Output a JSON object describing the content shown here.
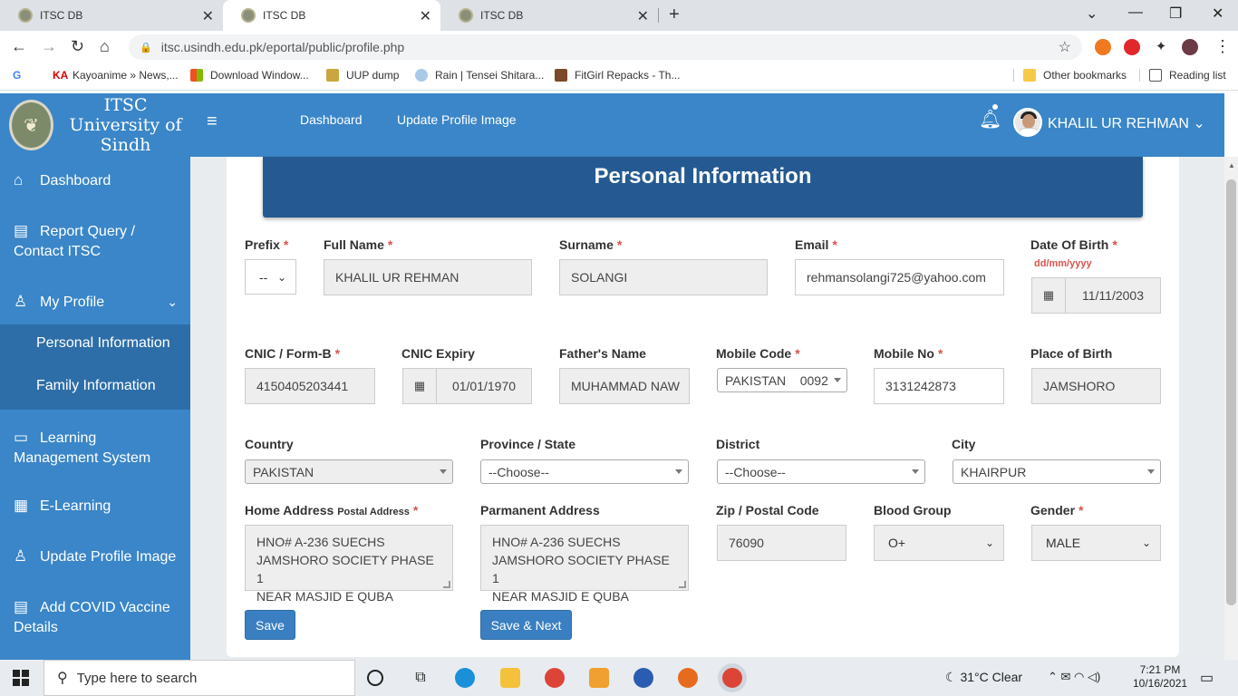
{
  "browser": {
    "tabs": [
      {
        "title": "ITSC DB",
        "close": "✕"
      },
      {
        "title": "ITSC DB",
        "close": "✕"
      },
      {
        "title": "ITSC DB",
        "close": "✕"
      }
    ],
    "new_tab": "+",
    "url": "itsc.usindh.edu.pk/eportal/public/profile.php",
    "bookmarks": [
      "Kayoanime » News,...",
      "Download Window...",
      "UUP dump",
      "Rain | Tensei Shitara...",
      "FitGirl Repacks - Th..."
    ],
    "other_bookmarks": "Other bookmarks",
    "reading_list": "Reading list"
  },
  "sidebar": {
    "brand_line1": "ITSC",
    "brand_line2": "University of Sindh",
    "items": [
      {
        "label": "Dashboard",
        "icon": "home-icon"
      },
      {
        "label": "Report Query /",
        "label2": "Contact ITSC",
        "icon": "document-icon"
      },
      {
        "label": "My Profile",
        "icon": "user-icon"
      },
      {
        "label": "Learning",
        "label2": "Management System",
        "icon": "lms-icon"
      },
      {
        "label": "E-Learning",
        "icon": "calculator-icon"
      },
      {
        "label": "Update Profile Image",
        "icon": "user-icon"
      },
      {
        "label": "Add COVID Vaccine",
        "label2": "Details",
        "icon": "document-icon"
      }
    ],
    "sub_items": [
      "Personal Information",
      "Family Information"
    ]
  },
  "header": {
    "links": [
      "Dashboard",
      "Update Profile Image"
    ],
    "user_name": "KHALIL UR REHMAN"
  },
  "form": {
    "title": "Personal Information",
    "prefix": {
      "label": "Prefix",
      "value": "--"
    },
    "full_name": {
      "label": "Full Name",
      "value": "KHALIL UR REHMAN"
    },
    "surname": {
      "label": "Surname",
      "value": "SOLANGI"
    },
    "email": {
      "label": "Email",
      "value": "rehmansolangi725@yahoo.com"
    },
    "dob": {
      "label": "Date Of Birth",
      "hint": "dd/mm/yyyy",
      "value": "11/11/2003"
    },
    "cnic": {
      "label": "CNIC / Form-B",
      "value": "4150405203441"
    },
    "cnic_expiry": {
      "label": "CNIC Expiry",
      "value": "01/01/1970"
    },
    "father_name": {
      "label": "Father's Name",
      "value": "MUHAMMAD NAW"
    },
    "mobile_code": {
      "label": "Mobile Code",
      "value": "PAKISTAN    0092"
    },
    "mobile_no": {
      "label": "Mobile No",
      "value": "3131242873"
    },
    "place_of_birth": {
      "label": "Place of Birth",
      "value": "JAMSHORO"
    },
    "country": {
      "label": "Country",
      "value": "PAKISTAN"
    },
    "province": {
      "label": "Province / State",
      "value": "--Choose--"
    },
    "district": {
      "label": "District",
      "value": "--Choose--"
    },
    "city": {
      "label": "City",
      "value": "KHAIRPUR"
    },
    "home_address": {
      "label": "Home Address",
      "sub": "Postal Address",
      "lines": [
        "HNO# A-236 SUECHS",
        "JAMSHORO SOCIETY PHASE 1",
        "NEAR MASJID E QUBA"
      ]
    },
    "permanent_address": {
      "label": "Parmanent Address",
      "lines": [
        "HNO# A-236 SUECHS",
        "JAMSHORO SOCIETY PHASE 1",
        "NEAR MASJID E QUBA"
      ]
    },
    "zip": {
      "label": "Zip / Postal Code",
      "value": "76090"
    },
    "blood_group": {
      "label": "Blood Group",
      "value": "O+"
    },
    "gender": {
      "label": "Gender",
      "value": "MALE"
    },
    "required_mark": "*",
    "save_label": "Save",
    "save_next_label": "Save & Next"
  },
  "taskbar": {
    "search_placeholder": "Type here to search",
    "weather": "31°C  Clear",
    "time": "7:21 PM",
    "date": "10/16/2021"
  },
  "colors": {
    "sidebar": "#3a86c8",
    "panel": "#245a91",
    "required": "#d9534f",
    "button": "#3a7fc1"
  }
}
